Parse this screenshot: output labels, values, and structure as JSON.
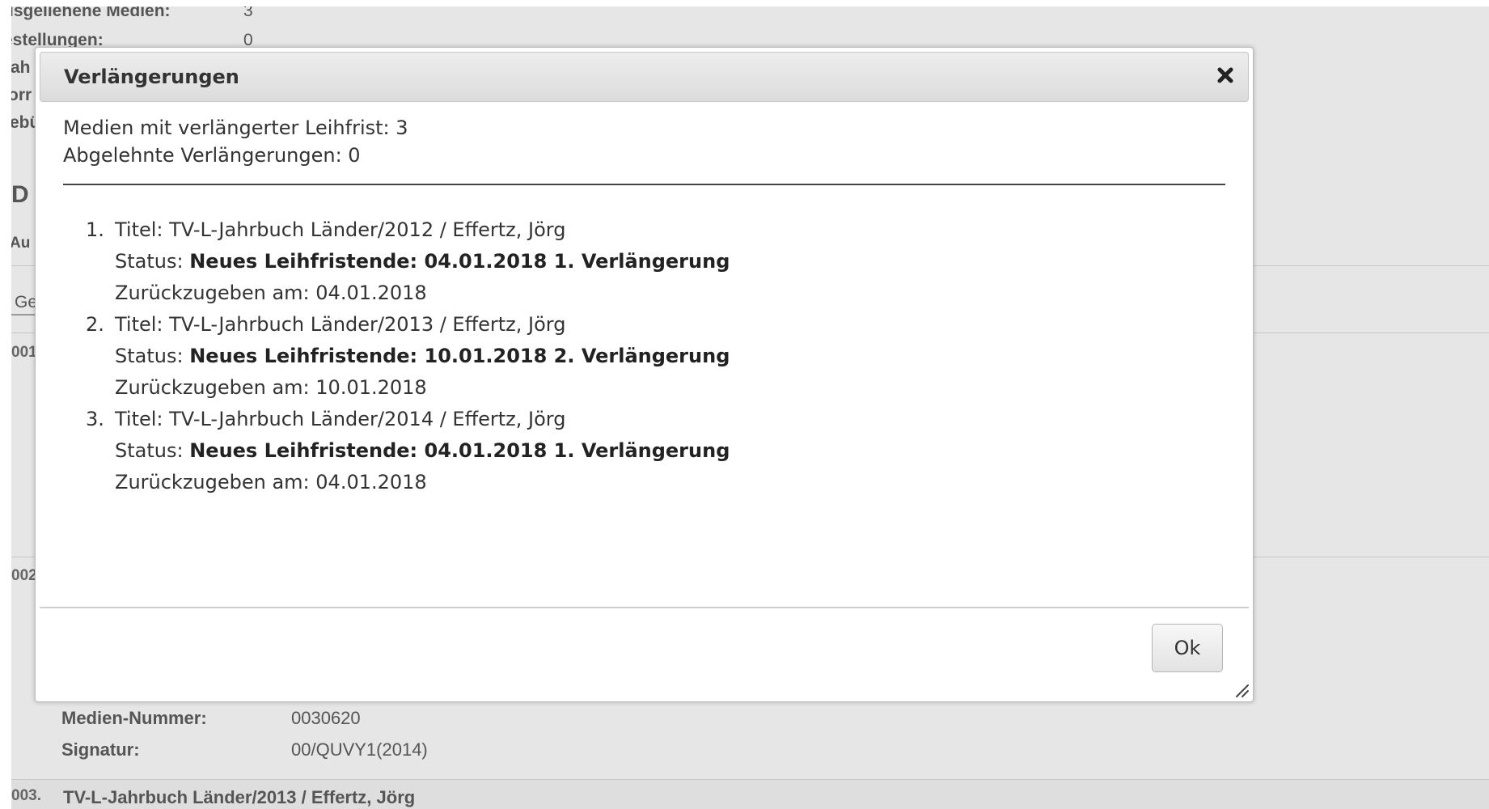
{
  "background": {
    "info_rows": [
      {
        "label": "usgeliehene Medien:",
        "value": "3"
      },
      {
        "label": "estellungen:",
        "value": "0"
      }
    ],
    "cut_labels": [
      "ah",
      "orr",
      "ebü"
    ],
    "section_title_fragment": "D",
    "section_sub_fragment": "Au",
    "tab_fragment": "Ge",
    "row_numbers": [
      "001",
      "002",
      "003."
    ],
    "details": {
      "media_number_label": "Medien-Nummer:",
      "media_number_value": "0030620",
      "signature_label": "Signatur:",
      "signature_value": "00/QUVY1(2014)"
    },
    "bottom_title": "TV-L-Jahrbuch Länder/2013 / Effertz, Jörg"
  },
  "dialog": {
    "title": "Verlängerungen",
    "close_icon": "close-icon",
    "summary": {
      "extended": "Medien mit verlängerter Leihfrist: 3",
      "rejected": "Abgelehnte Verlängerungen: 0"
    },
    "items": [
      {
        "number": "1.",
        "title": "Titel: TV-L-Jahrbuch Länder/2012 / Effertz, Jörg",
        "status_label": "Status: ",
        "status_value": "Neues Leihfristende: 04.01.2018 1. Verlängerung",
        "return_text": "Zurückzugeben am: 04.01.2018"
      },
      {
        "number": "2.",
        "title": "Titel: TV-L-Jahrbuch Länder/2013 / Effertz, Jörg",
        "status_label": "Status: ",
        "status_value": "Neues Leihfristende: 10.01.2018 2. Verlängerung",
        "return_text": "Zurückzugeben am: 10.01.2018"
      },
      {
        "number": "3.",
        "title": "Titel: TV-L-Jahrbuch Länder/2014 / Effertz, Jörg",
        "status_label": "Status: ",
        "status_value": "Neues Leihfristende: 04.01.2018 1. Verlängerung",
        "return_text": "Zurückzugeben am: 04.01.2018"
      }
    ],
    "ok_label": "Ok"
  }
}
